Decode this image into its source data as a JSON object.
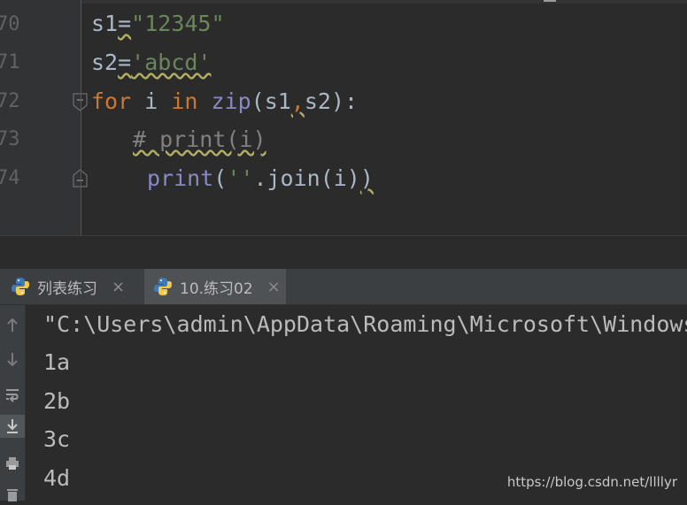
{
  "editor": {
    "line_numbers": [
      "70",
      "71",
      "72",
      "73",
      "74"
    ],
    "lines": [
      {
        "tokens": [
          {
            "t": "s1",
            "c": "def"
          },
          {
            "t": "=",
            "c": "wavy"
          },
          {
            "t": "\"12345\"",
            "c": "str"
          }
        ]
      },
      {
        "tokens": [
          {
            "t": "s2",
            "c": "def"
          },
          {
            "t": "=",
            "c": "wavy"
          },
          {
            "t": "'abcd'",
            "c": "str wavy"
          }
        ]
      },
      {
        "tokens": [
          {
            "t": "for",
            "c": "kw"
          },
          {
            "t": " i ",
            "c": "def"
          },
          {
            "t": "in",
            "c": "kw"
          },
          {
            "t": " ",
            "c": "def"
          },
          {
            "t": "zip",
            "c": "bi"
          },
          {
            "t": "(s1",
            "c": "def"
          },
          {
            "t": ",",
            "c": "kw wavy"
          },
          {
            "t": "s2):",
            "c": "def"
          }
        ]
      },
      {
        "tokens": [
          {
            "t": "# print(i)",
            "c": "cm wavy"
          }
        ]
      },
      {
        "tokens": [
          {
            "t": "print",
            "c": "bi"
          },
          {
            "t": "(",
            "c": "def"
          },
          {
            "t": "''",
            "c": "str"
          },
          {
            "t": ".join(i)",
            "c": "def"
          },
          {
            "t": ")",
            "c": "def wavy"
          }
        ]
      }
    ]
  },
  "tabs": [
    {
      "label": "列表练习",
      "icon": "python-icon",
      "active": false
    },
    {
      "label": "10.练习02",
      "icon": "python-icon",
      "active": true
    }
  ],
  "tab_close_glyph": "×",
  "toolstrip": {
    "icons": [
      "arrow-up-icon",
      "arrow-down-icon",
      "soft-wrap-icon",
      "scroll-to-end-icon",
      "print-icon",
      "delete-icon"
    ]
  },
  "console": {
    "lines": [
      "\"C:\\Users\\admin\\AppData\\Roaming\\Microsoft\\Windows",
      "1a",
      "2b",
      "3c",
      "4d"
    ]
  },
  "watermark": "https://blog.csdn.net/llllyr",
  "colors": {
    "keyword": "#cc7832",
    "string": "#6a8759",
    "builtin": "#8888c6",
    "comment": "#808080",
    "default": "#a9b7c6",
    "background": "#2b2b2b"
  }
}
